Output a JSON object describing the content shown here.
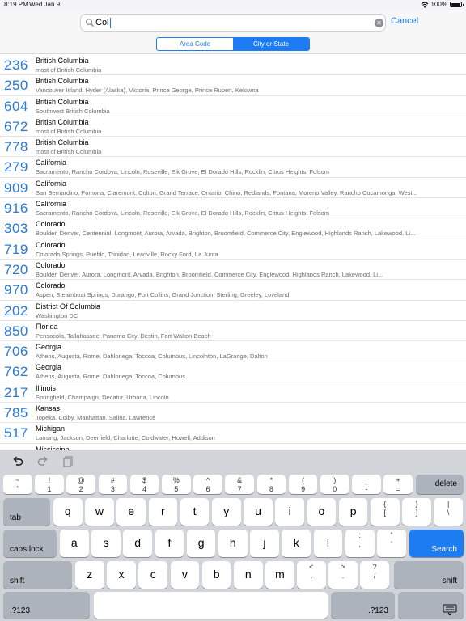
{
  "status": {
    "time": "8:19 PM",
    "date": "Wed Jan 9",
    "battery": "100%",
    "battery_level": 1.0
  },
  "search": {
    "value": "Col",
    "cancel_label": "Cancel"
  },
  "segments": {
    "area_code": "Area Code",
    "city_or_state": "City or State",
    "selected": "city_or_state"
  },
  "results": [
    {
      "code": "236",
      "state": "British Columbia",
      "cities": "most of British Columbia"
    },
    {
      "code": "250",
      "state": "British Columbia",
      "cities": "Vancouver Island, Hyder (Alaska), Victoria, Prince George, Prince Rupert, Kelowna"
    },
    {
      "code": "604",
      "state": "British Columbia",
      "cities": "Southwest British Columbia"
    },
    {
      "code": "672",
      "state": "British Columbia",
      "cities": "most of British Columbia"
    },
    {
      "code": "778",
      "state": "British Columbia",
      "cities": "most of British Columbia"
    },
    {
      "code": "279",
      "state": "California",
      "cities": "Sacramento, Rancho Cordova, Lincoln, Roseville, Elk Grove, El Dorado Hills, Rocklin, Citrus Heights, Folsom"
    },
    {
      "code": "909",
      "state": "California",
      "cities": "San Bernardino, Pomona, Claremont, Colton, Grand Terrace, Ontario, Chino, Redlands, Fontana, Moreno Valley, Rancho Cucamonga, West..."
    },
    {
      "code": "916",
      "state": "California",
      "cities": "Sacramento, Rancho Cordova, Lincoln, Roseville, Elk Grove, El Dorado Hills, Rocklin, Citrus Heights, Folsom"
    },
    {
      "code": "303",
      "state": "Colorado",
      "cities": "Boulder, Denver, Centennial, Longmont, Aurora, Arvada, Brighton, Broomfield, Commerce City, Englewood, Highlands Ranch, Lakewood, Li..."
    },
    {
      "code": "719",
      "state": "Colorado",
      "cities": "Colorado Springs, Pueblo, Trinidad, Leadville, Rocky Ford, La Junta"
    },
    {
      "code": "720",
      "state": "Colorado",
      "cities": "Boulder, Denver, Aurora, Longmont, Arvada, Brighton, Broomfield, Commerce City, Englewood, Highlands Ranch, Lakewood, Li..."
    },
    {
      "code": "970",
      "state": "Colorado",
      "cities": "Aspen, Steamboat Springs, Durango, Fort Collins, Grand Junction, Sterling, Greeley, Loveland"
    },
    {
      "code": "202",
      "state": "District Of Columbia",
      "cities": "Washington DC"
    },
    {
      "code": "850",
      "state": "Florida",
      "cities": "Pensacola, Tallahassee, Panama City, Destin, Fort Walton Beach"
    },
    {
      "code": "706",
      "state": "Georgia",
      "cities": "Athens, Augusta, Rome, Dahlonega, Toccoa, Columbus, Lincolnton, LaGrange, Dalton"
    },
    {
      "code": "762",
      "state": "Georgia",
      "cities": "Athens, Augusta, Rome, Dahlonega, Toccoa, Columbus"
    },
    {
      "code": "217",
      "state": "Illinois",
      "cities": "Springfield, Champaign, Decatur, Urbana, Lincoln"
    },
    {
      "code": "785",
      "state": "Kansas",
      "cities": "Topeka, Colby, Manhattan, Salina, Lawrence"
    },
    {
      "code": "517",
      "state": "Michigan",
      "cities": "Lansing, Jackson, Deerfield, Charlotte, Coldwater, Howell, Addison"
    },
    {
      "code": "",
      "state": "Mississippi",
      "cities": ""
    }
  ],
  "keyboard": {
    "number_row": [
      {
        "top": "~",
        "bottom": "`"
      },
      {
        "top": "!",
        "bottom": "1"
      },
      {
        "top": "@",
        "bottom": "2"
      },
      {
        "top": "#",
        "bottom": "3"
      },
      {
        "top": "$",
        "bottom": "4"
      },
      {
        "top": "%",
        "bottom": "5"
      },
      {
        "top": "^",
        "bottom": "6"
      },
      {
        "top": "&",
        "bottom": "7"
      },
      {
        "top": "*",
        "bottom": "8"
      },
      {
        "top": "(",
        "bottom": "9"
      },
      {
        "top": ")",
        "bottom": "0"
      },
      {
        "top": "_",
        "bottom": "-"
      },
      {
        "top": "+",
        "bottom": "="
      }
    ],
    "delete_label": "delete",
    "tab_label": "tab",
    "row_q": [
      "q",
      "w",
      "e",
      "r",
      "t",
      "y",
      "u",
      "i",
      "o",
      "p"
    ],
    "row_q_extra": [
      {
        "top": "{",
        "bottom": "["
      },
      {
        "top": "}",
        "bottom": "]"
      },
      {
        "top": "|",
        "bottom": "\\"
      }
    ],
    "caps_label": "caps lock",
    "row_a": [
      "a",
      "s",
      "d",
      "f",
      "g",
      "h",
      "j",
      "k",
      "l"
    ],
    "row_a_extra": [
      {
        "top": ":",
        "bottom": ";"
      },
      {
        "top": "”",
        "bottom": "'"
      }
    ],
    "search_label": "Search",
    "shift_label": "shift",
    "row_z": [
      "z",
      "x",
      "c",
      "v",
      "b",
      "n",
      "m"
    ],
    "row_z_extra": [
      {
        "top": "<",
        "bottom": ","
      },
      {
        "top": ">",
        "bottom": "."
      },
      {
        "top": "?",
        "bottom": "/"
      }
    ],
    "numbers_label": ".?123"
  },
  "icons": {
    "search": "search-icon",
    "clear": "clear-icon",
    "undo": "undo-icon",
    "redo": "redo-icon",
    "paste": "paste-icon",
    "keyboard_dismiss": "keyboard-dismiss-icon",
    "wifi": "wifi-icon",
    "battery": "battery-icon"
  },
  "colors": {
    "accent": "#1e7cf2",
    "code_text": "#2a7ad6",
    "subtitle": "#6d6d72"
  }
}
